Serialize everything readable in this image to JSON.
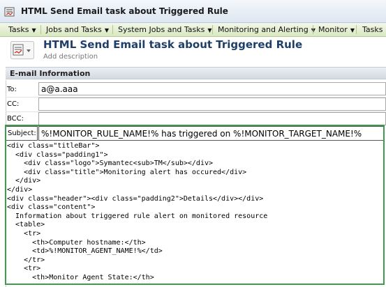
{
  "window": {
    "title": "HTML Send Email task about Triggered Rule"
  },
  "menu": {
    "items": [
      {
        "label": "Tasks"
      },
      {
        "label": "Jobs and Tasks"
      },
      {
        "label": "System Jobs and Tasks"
      },
      {
        "label": "Monitoring and Alerting"
      },
      {
        "label": "Monitor"
      },
      {
        "label": "Tasks"
      }
    ]
  },
  "header": {
    "title": "HTML Send Email task about Triggered Rule",
    "add_description": "Add description"
  },
  "section": {
    "title": "E-mail Information"
  },
  "fields": {
    "to_label": "To:",
    "to_value": "a@a.aaa",
    "cc_label": "CC:",
    "cc_value": "",
    "bcc_label": "BCC:",
    "bcc_value": "",
    "subject_label": "Subject:",
    "subject_value": "%!MONITOR_RULE_NAME!% has triggered on %!MONITOR_TARGET_NAME!%"
  },
  "body_lines": [
    "<div class=\"titleBar\">",
    "  <div class=\"padding1\">",
    "    <div class=\"logo\">Symantec<sub>TM</sub></div>",
    "    <div class=\"title\">Monitoring alert has occured</div>",
    "  </div>",
    "</div>",
    "<div class=\"header\"><div class=\"padding2\">Details</div></div>",
    "<div class=\"content\">",
    "  Information about triggered rule alert on monitored resource",
    "  <table>",
    "    <tr>",
    "      <th>Computer hostname:</th>",
    "      <td>%!MONITOR_AGENT_NAME!%</td>",
    "    </tr>",
    "    <tr>",
    "      <th>Monitor Agent State:</th>"
  ]
}
